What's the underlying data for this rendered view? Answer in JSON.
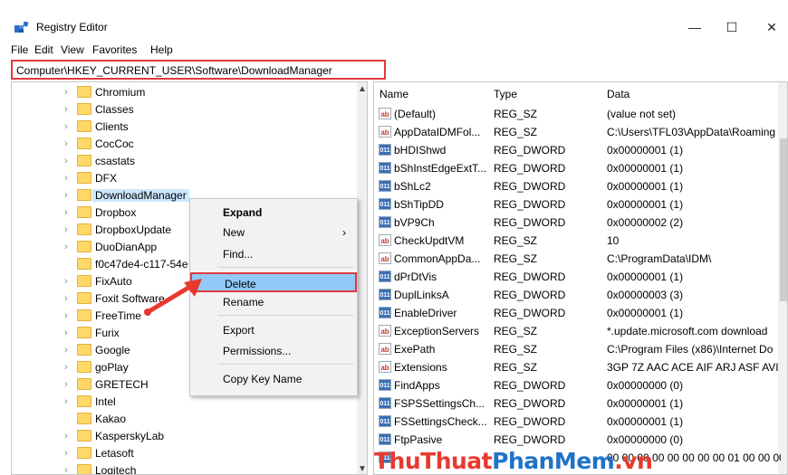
{
  "window": {
    "title": "Registry Editor",
    "minimize": "—",
    "maximize": "☐",
    "close": "✕"
  },
  "menu": [
    "File",
    "Edit",
    "View",
    "Favorites",
    "Help"
  ],
  "address": "Computer\\HKEY_CURRENT_USER\\Software\\DownloadManager",
  "tree": {
    "items": [
      {
        "label": "Chromium",
        "expandable": true
      },
      {
        "label": "Classes",
        "expandable": true
      },
      {
        "label": "Clients",
        "expandable": true
      },
      {
        "label": "CocCoc",
        "expandable": true
      },
      {
        "label": "csastats",
        "expandable": true
      },
      {
        "label": "DFX",
        "expandable": true
      },
      {
        "label": "DownloadManager",
        "expandable": true,
        "selected": true
      },
      {
        "label": "Dropbox",
        "expandable": true
      },
      {
        "label": "DropboxUpdate",
        "expandable": true
      },
      {
        "label": "DuoDianApp",
        "expandable": true
      },
      {
        "label": "f0c47de4-c117-54e",
        "expandable": false
      },
      {
        "label": "FixAuto",
        "expandable": true
      },
      {
        "label": "Foxit Software",
        "expandable": true
      },
      {
        "label": "FreeTime",
        "expandable": true
      },
      {
        "label": "Furix",
        "expandable": true
      },
      {
        "label": "Google",
        "expandable": true
      },
      {
        "label": "goPlay",
        "expandable": true
      },
      {
        "label": "GRETECH",
        "expandable": true
      },
      {
        "label": "Intel",
        "expandable": true
      },
      {
        "label": "Kakao",
        "expandable": false
      },
      {
        "label": "KasperskyLab",
        "expandable": true
      },
      {
        "label": "Letasoft",
        "expandable": true
      },
      {
        "label": "Logitech",
        "expandable": true
      }
    ]
  },
  "values": {
    "columns": {
      "name": "Name",
      "type": "Type",
      "data": "Data"
    },
    "rows": [
      {
        "kind": "sz",
        "name": "(Default)",
        "type": "REG_SZ",
        "data": "(value not set)"
      },
      {
        "kind": "sz",
        "name": "AppDataIDMFol...",
        "type": "REG_SZ",
        "data": "C:\\Users\\TFL03\\AppData\\Roaming"
      },
      {
        "kind": "dw",
        "name": "bHDIShwd",
        "type": "REG_DWORD",
        "data": "0x00000001 (1)"
      },
      {
        "kind": "dw",
        "name": "bShInstEdgeExtT...",
        "type": "REG_DWORD",
        "data": "0x00000001 (1)"
      },
      {
        "kind": "dw",
        "name": "bShLc2",
        "type": "REG_DWORD",
        "data": "0x00000001 (1)"
      },
      {
        "kind": "dw",
        "name": "bShTipDD",
        "type": "REG_DWORD",
        "data": "0x00000001 (1)"
      },
      {
        "kind": "dw",
        "name": "bVP9Ch",
        "type": "REG_DWORD",
        "data": "0x00000002 (2)"
      },
      {
        "kind": "sz",
        "name": "CheckUpdtVM",
        "type": "REG_SZ",
        "data": "10"
      },
      {
        "kind": "sz",
        "name": "CommonAppDa...",
        "type": "REG_SZ",
        "data": "C:\\ProgramData\\IDM\\"
      },
      {
        "kind": "dw",
        "name": "dPrDtVis",
        "type": "REG_DWORD",
        "data": "0x00000001 (1)"
      },
      {
        "kind": "dw",
        "name": "DuplLinksA",
        "type": "REG_DWORD",
        "data": "0x00000003 (3)"
      },
      {
        "kind": "dw",
        "name": "EnableDriver",
        "type": "REG_DWORD",
        "data": "0x00000001 (1)"
      },
      {
        "kind": "sz",
        "name": "ExceptionServers",
        "type": "REG_SZ",
        "data": "*.update.microsoft.com download"
      },
      {
        "kind": "sz",
        "name": "ExePath",
        "type": "REG_SZ",
        "data": "C:\\Program Files (x86)\\Internet Do"
      },
      {
        "kind": "sz",
        "name": "Extensions",
        "type": "REG_SZ",
        "data": "3GP 7Z AAC ACE AIF ARJ ASF AVI E"
      },
      {
        "kind": "dw",
        "name": "FindApps",
        "type": "REG_DWORD",
        "data": "0x00000000 (0)"
      },
      {
        "kind": "dw",
        "name": "FSPSSettingsCh...",
        "type": "REG_DWORD",
        "data": "0x00000001 (1)"
      },
      {
        "kind": "dw",
        "name": "FSSettingsCheck...",
        "type": "REG_DWORD",
        "data": "0x00000001 (1)"
      },
      {
        "kind": "dw",
        "name": "FtpPasive",
        "type": "REG_DWORD",
        "data": "0x00000000 (0)"
      },
      {
        "kind": "dw",
        "name": "",
        "type": "",
        "data": "00 00 00 00 00 00 00 00 01 00 00 00"
      }
    ]
  },
  "context_menu": {
    "items": [
      {
        "label": "Expand",
        "bold": true
      },
      {
        "label": "New",
        "submenu": "›"
      },
      {
        "label": "Find..."
      },
      {
        "label": "Delete",
        "highlight": true
      },
      {
        "label": "Rename"
      },
      {
        "label": "Export"
      },
      {
        "label": "Permissions..."
      },
      {
        "label": "Copy Key Name"
      }
    ]
  },
  "watermark": {
    "part1": "ThuThuat",
    "part2": "PhanMem",
    "part3": ".vn"
  },
  "colors": {
    "highlight_border": "#e0393e",
    "selection": "#91c9f7",
    "watermark_red": "#e8392f",
    "watermark_blue": "#1e73c8"
  }
}
